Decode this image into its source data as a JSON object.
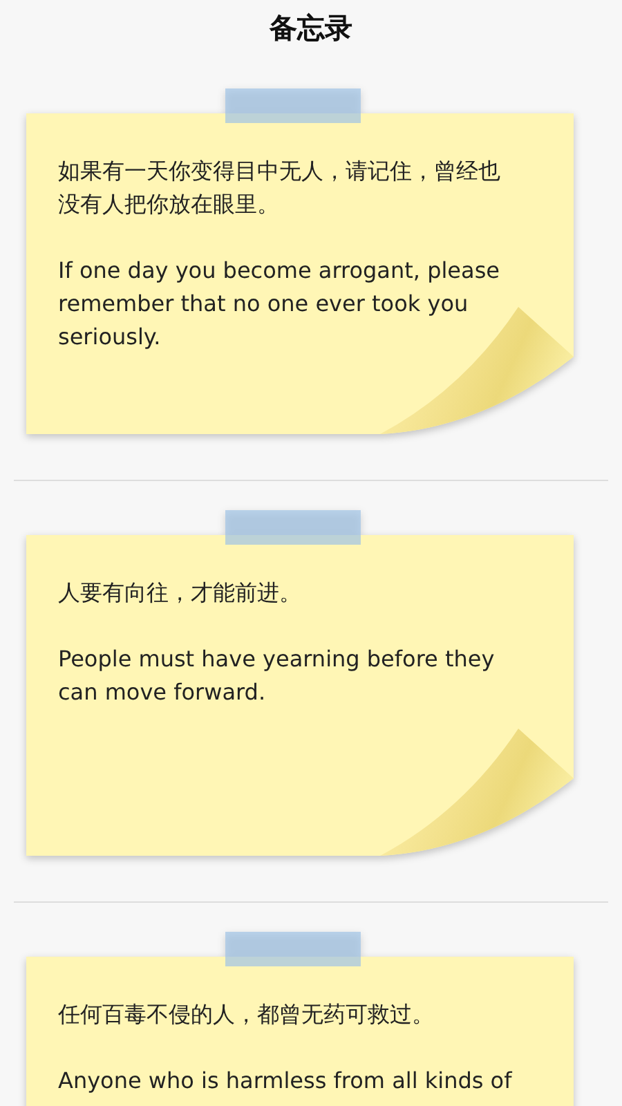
{
  "title": "备忘录",
  "notes": [
    {
      "paragraphs": [
        "如果有一天你变得目中无人，请记住，曾经也没有人把你放在眼里。",
        "If one day you become arrogant, please remember that no one ever took you seriously."
      ]
    },
    {
      "paragraphs": [
        "人要有向往，才能前进。",
        "People must have yearning before they can move forward."
      ]
    },
    {
      "paragraphs": [
        "任何百毒不侵的人，都曾无药可救过。",
        "Anyone who is harmless from all kinds of"
      ]
    }
  ]
}
